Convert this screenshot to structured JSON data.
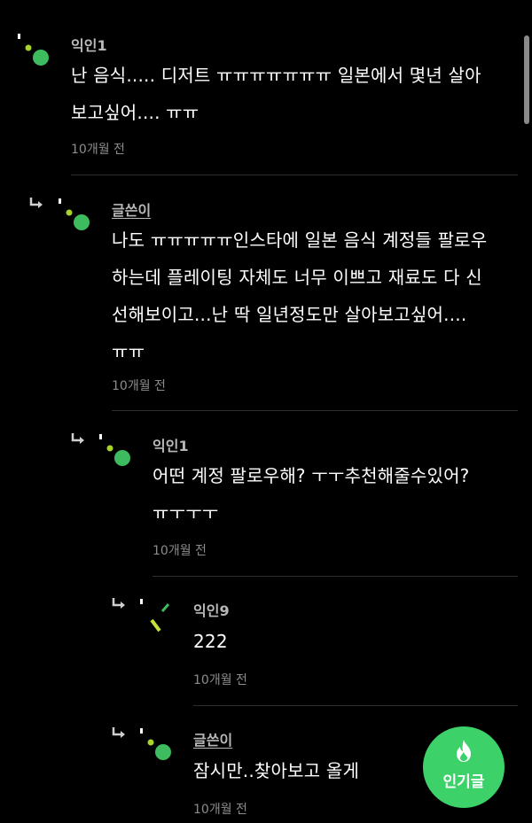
{
  "comments": [
    {
      "author": "익인1",
      "lines": [
        "난 음식..... 디저트 ㅠㅠㅠㅠㅠㅠㅠ 일본에서 몇년 살아",
        "보고싶어.... ㅠㅠ"
      ],
      "time": "10개월 전"
    },
    {
      "author": "글쓴이",
      "lines": [
        "나도 ㅠㅠㅠㅠㅠ인스타에 일본 음식 계정들 팔로우",
        "하는데 플레이팅 자체도 너무 이쁘고 재료도 다 신",
        "선해보이고...난 딱 일년정도만 살아보고싶어....",
        "ㅠㅠ"
      ],
      "time": "10개월 전"
    },
    {
      "author": "익인1",
      "lines": [
        "어떤 계정 팔로우해? ㅜㅜ추천해줄수있어?",
        "ㅠㅜㅜㅜ"
      ],
      "time": "10개월 전"
    },
    {
      "author": "익인9",
      "lines": [
        "222"
      ],
      "time": "10개월 전"
    },
    {
      "author": "글쓴이",
      "lines": [
        "잠시만..찾아보고 올게"
      ],
      "time": "10개월 전"
    }
  ],
  "fab": {
    "label": "인기글",
    "icon": "fire-icon"
  },
  "colors": {
    "background": "#000000",
    "avatar_green": "#3dbb5e",
    "avatar_lime": "#a8d42a",
    "fab_green": "#3dd16a"
  }
}
